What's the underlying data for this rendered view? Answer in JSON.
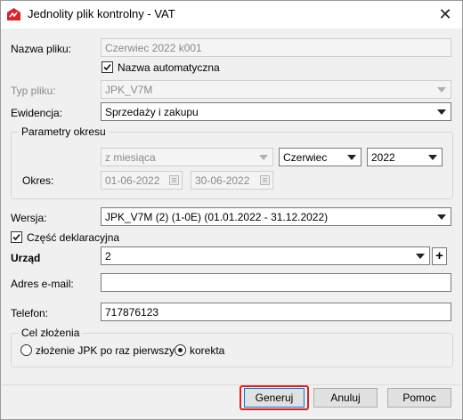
{
  "window": {
    "title": "Jednolity plik kontrolny - VAT",
    "close_label": "✕"
  },
  "form": {
    "nazwa_pliku": {
      "label": "Nazwa pliku:",
      "value": "Czerwiec 2022 k001"
    },
    "nazwa_automatyczna": {
      "label": "Nazwa automatyczna",
      "checked": true
    },
    "typ_pliku": {
      "label": "Typ pliku:",
      "value": "JPK_V7M"
    },
    "ewidencja": {
      "label": "Ewidencja:",
      "value": "Sprzedaży i zakupu"
    },
    "parametry": {
      "legend": "Parametry okresu",
      "okres_typ": "z miesiąca",
      "miesiac": "Czerwiec",
      "rok": "2022",
      "okres_label": "Okres:",
      "data_od": "01-06-2022",
      "data_do": "30-06-2022"
    },
    "wersja": {
      "label": "Wersja:",
      "value": "JPK_V7M (2) (1-0E) (01.01.2022 - 31.12.2022)"
    },
    "czesc_deklaracyjna": {
      "label": "Część deklaracyjna",
      "checked": true
    },
    "urzad": {
      "label": "Urząd",
      "value": "2",
      "add_label": "+"
    },
    "email": {
      "label": "Adres e-mail:",
      "value": ""
    },
    "telefon": {
      "label": "Telefon:",
      "value": "717876123"
    },
    "cel_zlozenia": {
      "legend": "Cel złożenia",
      "option1": "złożenie JPK po raz pierwszy",
      "option2": "korekta",
      "selected": "korekta"
    }
  },
  "buttons": {
    "generuj": "Generuj",
    "anuluj": "Anuluj",
    "pomoc": "Pomoc"
  },
  "colors": {
    "highlight": "#e02020",
    "app_icon": "#d8232a"
  }
}
